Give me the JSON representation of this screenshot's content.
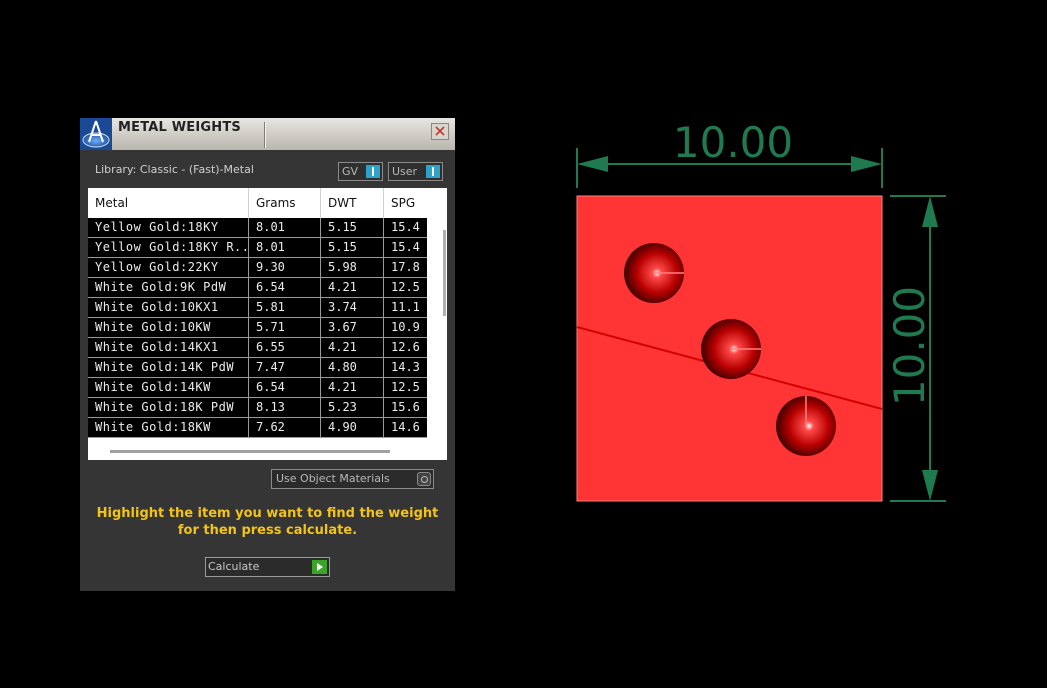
{
  "panel": {
    "title": "METAL WEIGHTS",
    "library_label": "Library: Classic - (Fast)-Metal",
    "toggles": [
      {
        "label": "GV",
        "state": "on"
      },
      {
        "label": "User",
        "state": "on"
      }
    ],
    "table": {
      "columns": [
        "Metal",
        "Grams",
        "DWT",
        "SPG"
      ],
      "rows": [
        [
          "Yellow Gold:18KY",
          "8.01",
          "5.15",
          "15.4"
        ],
        [
          "Yellow Gold:18KY R...",
          "8.01",
          "5.15",
          "15.4"
        ],
        [
          "Yellow Gold:22KY",
          "9.30",
          "5.98",
          "17.8"
        ],
        [
          "White Gold:9K PdW",
          "6.54",
          "4.21",
          "12.5"
        ],
        [
          "White Gold:10KX1",
          "5.81",
          "3.74",
          "11.1"
        ],
        [
          "White Gold:10KW",
          "5.71",
          "3.67",
          "10.9"
        ],
        [
          "White Gold:14KX1",
          "6.55",
          "4.21",
          "12.6"
        ],
        [
          "White Gold:14K PdW",
          "7.47",
          "4.80",
          "14.3"
        ],
        [
          "White Gold:14KW",
          "6.54",
          "4.21",
          "12.5"
        ],
        [
          "White Gold:18K PdW",
          "8.13",
          "5.23",
          "15.6"
        ],
        [
          "White Gold:18KW",
          "7.62",
          "4.90",
          "14.6"
        ]
      ]
    },
    "use_object_materials": "Use Object Materials",
    "help_line1": "Highlight the item you want to find the weight",
    "help_line2": "for then press calculate.",
    "calculate_label": "Calculate"
  },
  "viewport": {
    "width_dimension": "10.00",
    "height_dimension": "10.00",
    "shape_color": "#ff3535",
    "dimension_color": "#1f7a4f",
    "gem_count": 3
  },
  "colors": {
    "panel_bg": "#353535",
    "accent_toggle": "#2ea3c7",
    "help_text": "#f2c318",
    "calculate_green": "#3aa528"
  }
}
